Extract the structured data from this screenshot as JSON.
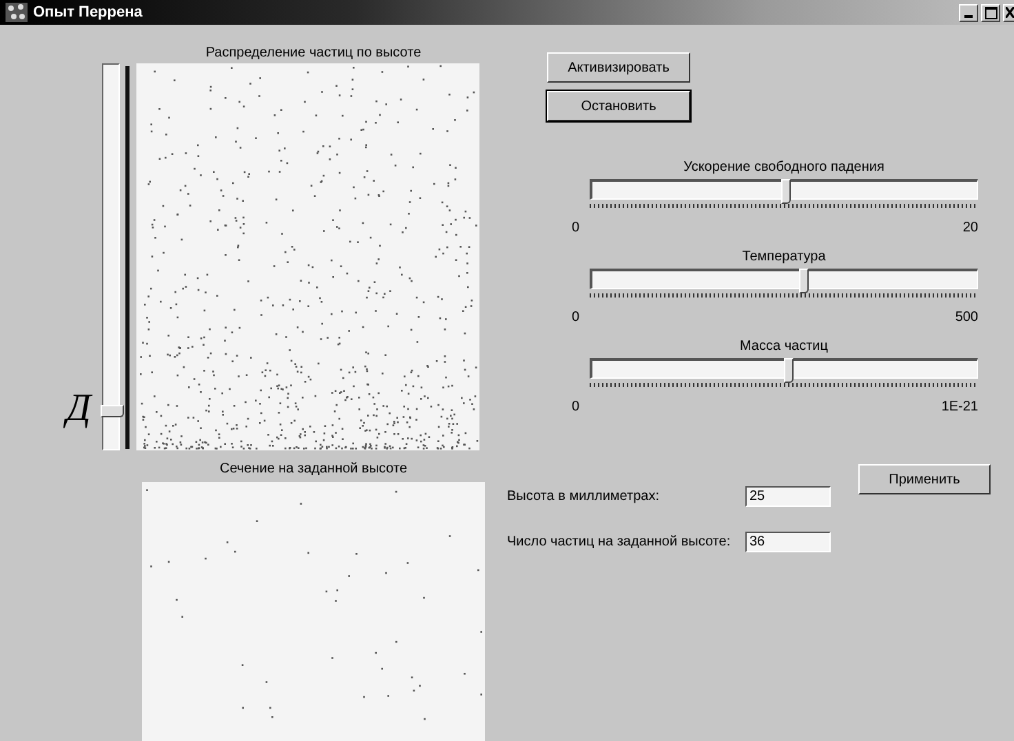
{
  "window": {
    "title": "Опыт Перрена"
  },
  "distribution_title": "Распределение  частиц по высоте",
  "height_slider": {
    "label": "Д",
    "level": 0.09
  },
  "section_title": "Сечение на заданной высоте",
  "buttons": [
    {
      "label": "Активизировать",
      "focused": false
    },
    {
      "label": "Остановить",
      "focused": true
    }
  ],
  "sliders": [
    {
      "label": "Ускорение свободного падения",
      "min": "0",
      "max": "20",
      "level": 0.5
    },
    {
      "label": "Температура",
      "min": "0",
      "max": "500",
      "level": 0.55
    },
    {
      "label": "Масса частиц",
      "min": "0",
      "max": "1E-21",
      "level": 0.51
    }
  ],
  "fields": [
    {
      "label": "Высота в миллиметрах:",
      "value": "25"
    },
    {
      "label": "Число частиц на заданной высоте:",
      "value": "36"
    }
  ],
  "apply_button": {
    "label": "Применить"
  }
}
